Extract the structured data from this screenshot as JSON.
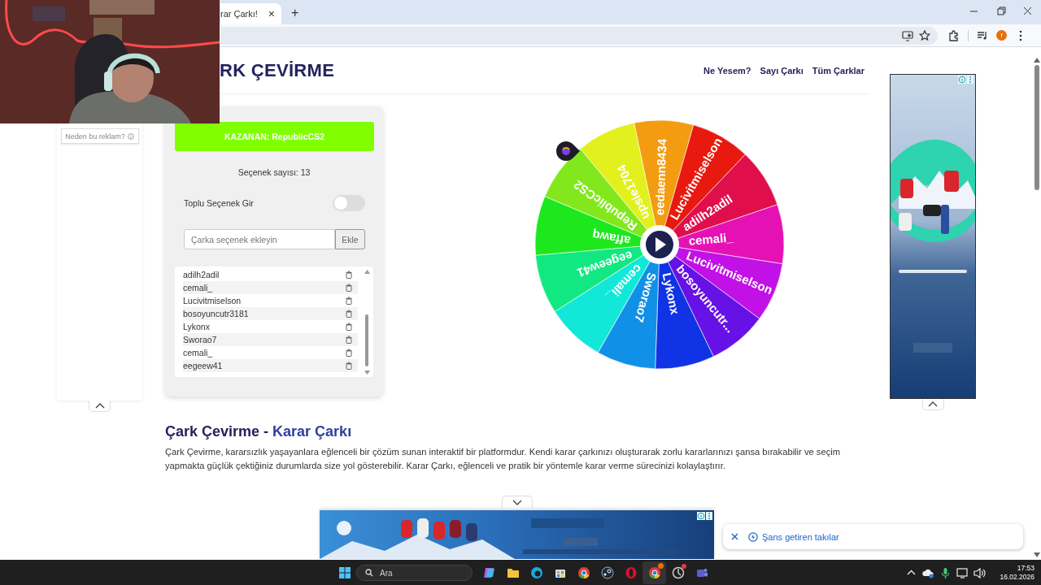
{
  "browser": {
    "tab_title": "rar Çarkı!",
    "tab_close": "×",
    "new_tab": "+",
    "profile_initial": "f"
  },
  "header": {
    "logo": "RK ÇEVİRME",
    "nav": [
      "Ne Yesem?",
      "Sayı Çarkı",
      "Tüm Çarklar"
    ]
  },
  "left_ad": {
    "why_label": "Neden bu reklam?"
  },
  "panel": {
    "winner": "KAZANAN: RepublicCS2",
    "count": "Seçenek sayısı: 13",
    "bulk_label": "Toplu Seçenek Gir",
    "bulk_on": false,
    "input_placeholder": "Çarka seçenek ekleyin",
    "add_button": "Ekle",
    "options": [
      "adilh2adil",
      "cemali_",
      "Lucivitmiselson",
      "bosoyuncutr3181",
      "Lykonx",
      "Sworao7",
      "cemali_",
      "eegeew41"
    ]
  },
  "wheel": {
    "segments": [
      {
        "label": "eedaenn8434",
        "color": "#f39c12"
      },
      {
        "label": "Lucivitmiselson",
        "color": "#e8190f"
      },
      {
        "label": "adilh2adil",
        "color": "#e00f4c"
      },
      {
        "label": "cemali_",
        "color": "#e611b4"
      },
      {
        "label": "Lucivitmiselson",
        "color": "#c111e6"
      },
      {
        "label": "bosoyuncutr...",
        "color": "#6611e6"
      },
      {
        "label": "Lykonx",
        "color": "#1133e6"
      },
      {
        "label": "Sworao7",
        "color": "#1190e8"
      },
      {
        "label": "cemali_",
        "color": "#11e8d8"
      },
      {
        "label": "eegeew41",
        "color": "#11e882"
      },
      {
        "label": "affawq",
        "color": "#1de81d"
      },
      {
        "label": "RepublicCS2",
        "color": "#82e81d"
      },
      {
        "label": "upsie1704",
        "color": "#e2f01d"
      }
    ]
  },
  "article": {
    "title": "Çark Çevirme - ",
    "title_highlight": "Karar Çarkı",
    "text": "Çark Çevirme, kararsızlık yaşayanlara eğlenceli bir çözüm sunan interaktif bir platformdur. Kendi karar çarkınızı oluşturarak zorlu kararlarınızı şansa bırakabilir ve seçim yapmakta güçlük çektiğiniz durumlarda size yol gösterebilir. Karar Çarkı, eğlenceli ve pratik bir yöntemle karar verme sürecinizi kolaylaştırır."
  },
  "notification": {
    "text": "Şans getiren takılar"
  },
  "taskbar": {
    "search_placeholder": "Ara",
    "time": "17:53",
    "date": "16.02.2026"
  }
}
